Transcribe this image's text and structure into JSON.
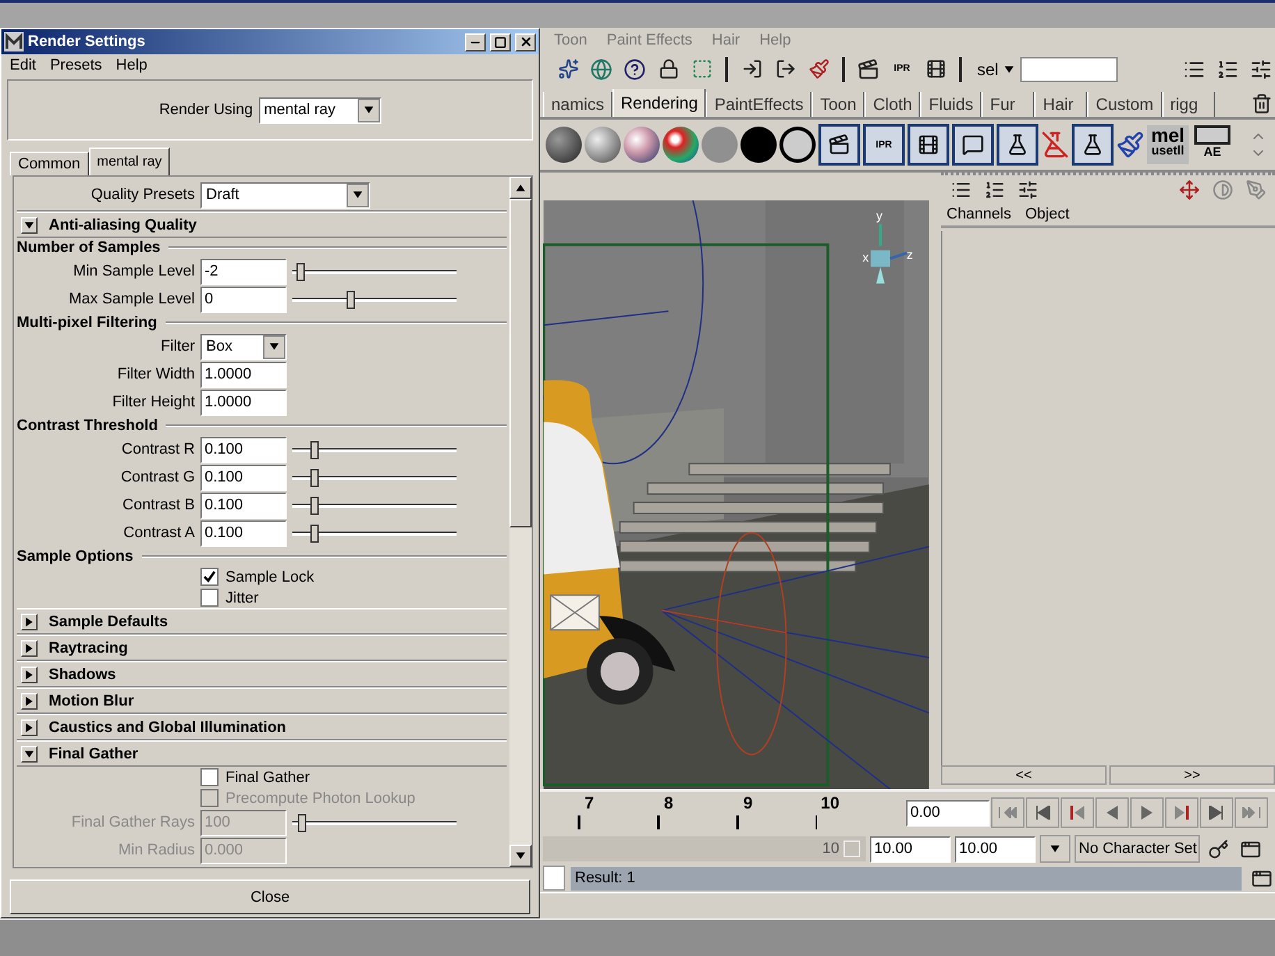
{
  "main": {
    "menu": [
      "Toon",
      "Paint Effects",
      "Hair",
      "Help"
    ],
    "toolbar": {
      "icon_caption": "IPR",
      "selection_label": "sel"
    },
    "shelf_tabs": [
      {
        "label": "namics",
        "selected": false
      },
      {
        "label": "Rendering",
        "selected": true
      },
      {
        "label": "PaintEffects",
        "selected": false
      },
      {
        "label": "Toon",
        "selected": false
      },
      {
        "label": "Cloth",
        "selected": false
      },
      {
        "label": "Fluids",
        "selected": false
      },
      {
        "label": "Fur",
        "selected": false
      },
      {
        "label": "Hair",
        "selected": false
      },
      {
        "label": "Custom",
        "selected": false
      },
      {
        "label": "rigg",
        "selected": false
      }
    ],
    "shelf": {
      "icon_caption": "IPR",
      "mel_lines": [
        "mel",
        "usetll"
      ],
      "ae_label": "AE"
    },
    "viewport": {
      "axis_labels": [
        "y",
        "x",
        "z"
      ]
    },
    "channel_box": {
      "tabs": [
        "Channels",
        "Object"
      ],
      "scroll_buttons": [
        "<<",
        ">>"
      ]
    },
    "timeline": {
      "ticks": [
        "7",
        "8",
        "9",
        "10"
      ],
      "current_time": "0.00"
    },
    "range": {
      "level": 1,
      "end_label": "10",
      "start": "10.00",
      "end": "10.00",
      "character_set": "No Character Set"
    },
    "command_line": {
      "result": "Result: 1"
    }
  },
  "dialog": {
    "title": "Render Settings",
    "menu": [
      "Edit",
      "Presets",
      "Help"
    ],
    "render_using": {
      "label": "Render Using",
      "value": "mental ray"
    },
    "tabs": [
      {
        "label": "Common",
        "selected": false
      },
      {
        "label": "mental ray",
        "selected": true
      }
    ],
    "quality_presets": {
      "label": "Quality Presets",
      "value": "Draft"
    },
    "sections": [
      {
        "title": "Anti-aliasing Quality",
        "expanded": true,
        "groups": [
          {
            "title": "Number of Samples",
            "rows": [
              {
                "kind": "slider",
                "label": "Min Sample Level",
                "value": "-2",
                "level": 0.03,
                "disabled": false
              },
              {
                "kind": "slider",
                "label": "Max Sample Level",
                "value": "0",
                "level": 0.35,
                "disabled": false
              }
            ]
          },
          {
            "title": "Multi-pixel Filtering",
            "rows": [
              {
                "kind": "dropdown",
                "label": "Filter",
                "value": "Box",
                "disabled": false
              },
              {
                "kind": "field",
                "label": "Filter Width",
                "value": "1.0000",
                "disabled": false
              },
              {
                "kind": "field",
                "label": "Filter Height",
                "value": "1.0000",
                "disabled": false
              }
            ]
          },
          {
            "title": "Contrast Threshold",
            "rows": [
              {
                "kind": "slider",
                "label": "Contrast R",
                "value": "0.100",
                "level": 0.12,
                "disabled": false
              },
              {
                "kind": "slider",
                "label": "Contrast G",
                "value": "0.100",
                "level": 0.12,
                "disabled": false
              },
              {
                "kind": "slider",
                "label": "Contrast B",
                "value": "0.100",
                "level": 0.12,
                "disabled": false
              },
              {
                "kind": "slider",
                "label": "Contrast A",
                "value": "0.100",
                "level": 0.12,
                "disabled": false
              }
            ]
          },
          {
            "title": "Sample Options",
            "rows": [
              {
                "kind": "checkbox",
                "label": "Sample Lock",
                "checked": true,
                "disabled": false
              },
              {
                "kind": "checkbox",
                "label": "Jitter",
                "checked": false,
                "disabled": false
              }
            ]
          }
        ]
      },
      {
        "title": "Sample Defaults",
        "expanded": false
      },
      {
        "title": "Raytracing",
        "expanded": false
      },
      {
        "title": "Shadows",
        "expanded": false
      },
      {
        "title": "Motion Blur",
        "expanded": false
      },
      {
        "title": "Caustics and Global Illumination",
        "expanded": false
      },
      {
        "title": "Final Gather",
        "expanded": true,
        "groups": [
          {
            "rows": [
              {
                "kind": "checkbox",
                "label": "Final Gather",
                "checked": false,
                "disabled": false
              },
              {
                "kind": "checkbox",
                "label": "Precompute Photon Lookup",
                "checked": false,
                "disabled": true
              },
              {
                "kind": "slider",
                "label": "Final Gather Rays",
                "value": "100",
                "level": 0.04,
                "disabled": true
              },
              {
                "kind": "field",
                "label": "Min Radius",
                "value": "0.000",
                "disabled": true
              }
            ]
          }
        ]
      }
    ],
    "close_button": "Close"
  }
}
